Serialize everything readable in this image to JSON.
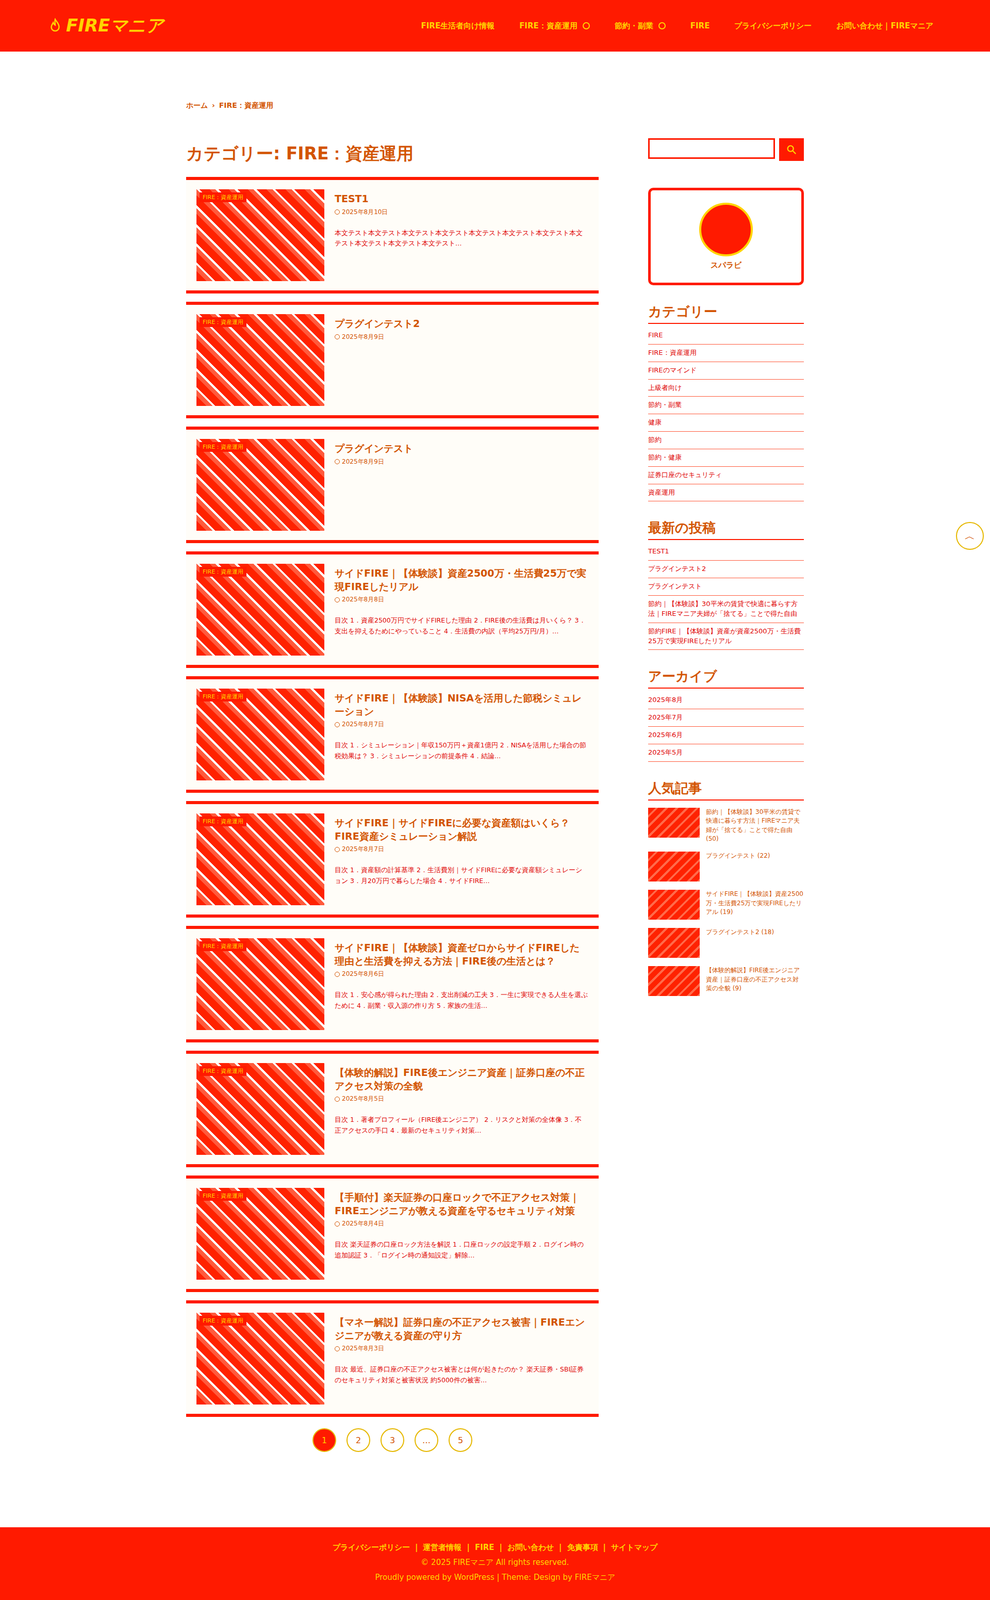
{
  "header": {
    "logo": "FIREマニア",
    "nav": [
      {
        "label": "FIRE生活者向け情報",
        "has_submenu": false
      },
      {
        "label": "FIRE：資産運用",
        "has_submenu": true
      },
      {
        "label": "節約・副業",
        "has_submenu": true
      },
      {
        "label": "FIRE",
        "has_submenu": false
      },
      {
        "label": "プライバシーポリシー",
        "has_submenu": false
      },
      {
        "label": "お問い合わせ｜FIREマニア",
        "has_submenu": false
      }
    ]
  },
  "breadcrumb": [
    "ホーム",
    "›",
    "FIRE：資産運用"
  ],
  "page_title": "カテゴリー: FIRE：資産運用",
  "posts": [
    {
      "badge": "FIRE：資産運用",
      "title": "TEST1",
      "date": "2025年8月10日",
      "excerpt": "本文テスト本文テスト本文テスト本文テスト本文テスト本文テスト本文テスト本文テスト本文テスト本文テスト本文テスト…"
    },
    {
      "badge": "FIRE：資産運用",
      "title": "プラグインテスト2",
      "date": "2025年8月9日",
      "excerpt": ""
    },
    {
      "badge": "FIRE：資産運用",
      "title": "プラグインテスト",
      "date": "2025年8月9日",
      "excerpt": ""
    },
    {
      "badge": "FIRE：資産運用",
      "title": "サイドFIRE｜【体験談】資産2500万・生活費25万で実現FIREしたリアル",
      "date": "2025年8月8日",
      "excerpt": "目次 1．資産2500万円でサイドFIREした理由 2．FIRE後の生活費は月いくら？ 3．支出を抑えるためにやっていること 4．生活費の内訳（平均25万円/月）…"
    },
    {
      "badge": "FIRE：資産運用",
      "title": "サイドFIRE｜【体験談】NISAを活用した節税シミュレーション",
      "date": "2025年8月7日",
      "excerpt": "目次 1．シミュレーション｜年収150万円＋資産1億円 2．NISAを活用した場合の節税効果は？ 3．シミュレーションの前提条件 4．結論…"
    },
    {
      "badge": "FIRE：資産運用",
      "title": "サイドFIRE｜サイドFIREに必要な資産額はいくら？FIRE資産シミュレーション解説",
      "date": "2025年8月7日",
      "excerpt": "目次 1．資産額の計算基準 2．生活費別｜サイドFIREに必要な資産額シミュレーション 3．月20万円で暮らした場合 4．サイドFIRE…"
    },
    {
      "badge": "FIRE：資産運用",
      "title": "サイドFIRE｜【体験談】資産ゼロからサイドFIREした理由と生活費を抑える方法｜FIRE後の生活とは？",
      "date": "2025年8月6日",
      "excerpt": "目次 1．安心感が得られた理由 2．支出削減の工夫 3．一生に実現できる人生を選ぶために 4．副業・収入源の作り方 5．家族の生活…"
    },
    {
      "badge": "FIRE：資産運用",
      "title": "【体験的解説】FIRE後エンジニア資産｜証券口座の不正アクセス対策の全貌",
      "date": "2025年8月5日",
      "excerpt": "目次 1．著者プロフィール（FIRE後エンジニア） 2．リスクと対策の全体像 3．不正アクセスの手口 4．最新のセキュリティ対策…"
    },
    {
      "badge": "FIRE：資産運用",
      "title": "【手順付】楽天証券の口座ロックで不正アクセス対策｜FIREエンジニアが教える資産を守るセキュリティ対策",
      "date": "2025年8月4日",
      "excerpt": "目次 楽天証券の口座ロック方法を解説 1．口座ロックの設定手順 2．ログイン時の追加認証 3．「ログイン時の通知設定」解除…"
    },
    {
      "badge": "FIRE：資産運用",
      "title": "【マネー解説】証券口座の不正アクセス被害｜FIREエンジニアが教える資産の守り方",
      "date": "2025年8月3日",
      "excerpt": "目次 最近、証券口座の不正アクセス被害とは何が起きたのか？ 楽天証券・SBI証券のセキュリティ対策と被害状況 約5000件の被害…"
    }
  ],
  "pagination": [
    {
      "label": "1",
      "selected": true
    },
    {
      "label": "2",
      "selected": false
    },
    {
      "label": "3",
      "selected": false
    },
    {
      "label": "…",
      "selected": false
    },
    {
      "label": "5",
      "selected": false
    }
  ],
  "sidebar": {
    "profile": {
      "name": "スパラビ"
    },
    "categories": {
      "title": "カテゴリー",
      "items": [
        "FIRE",
        "FIRE：資産運用",
        "FIREのマインド",
        "上級者向け",
        "節約・副業",
        "健康",
        "節約",
        "節約・健康",
        "証券口座のセキュリティ",
        "資産運用"
      ]
    },
    "recent": {
      "title": "最新の投稿",
      "items": [
        "TEST1",
        "プラグインテスト2",
        "プラグインテスト",
        "節約｜【体験談】30平米の賃貸で快適に暮らす方法｜FIREマニア夫婦が「捨てる」ことで得た自由",
        "節約FIRE｜【体験談】資産が資産2500万・生活費25万で実現FIREしたリアル"
      ]
    },
    "archive": {
      "title": "アーカイブ",
      "items": [
        "2025年8月",
        "2025年7月",
        "2025年6月",
        "2025年5月"
      ]
    },
    "popular": {
      "title": "人気記事",
      "items": [
        "節約｜【体験談】30平米の賃貸で快適に暮らす方法｜FIREマニア夫婦が「捨てる」ことで得た自由 (50)",
        "プラグインテスト (22)",
        "サイドFIRE｜【体験談】資産2500万・生活費25万で実現FIREしたリアル (19)",
        "プラグインテスト2 (18)",
        "【体験的解説】FIRE後エンジニア資産｜証券口座の不正アクセス対策の全貌 (9)"
      ]
    }
  },
  "back_to_top": "︿",
  "footer": {
    "links": [
      "プライバシーポリシー",
      "運営者情報",
      "FIRE",
      "お問い合わせ",
      "免責事項",
      "サイトマップ"
    ],
    "separator": "|",
    "copyright": "© 2025 FIREマニア All rights reserved.",
    "powered": "Proudly powered by WordPress | Theme: Design by FIREマニア"
  }
}
